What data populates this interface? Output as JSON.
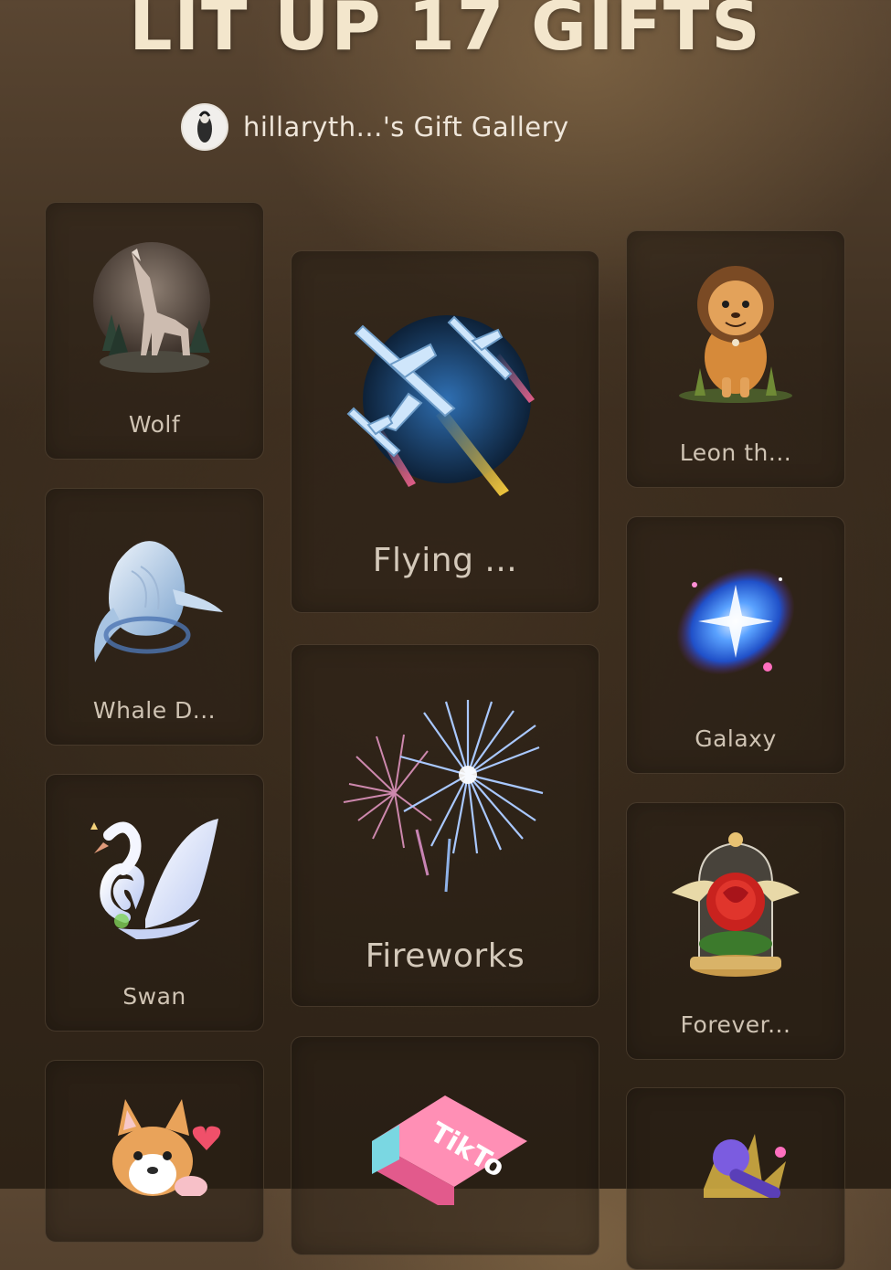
{
  "header": {
    "title": "LIT UP 17 GIFTS",
    "gallery_title": "hillaryth...'s Gift Gallery"
  },
  "gifts": {
    "wolf": {
      "label": "Wolf",
      "icon": "wolf-icon"
    },
    "flying": {
      "label": "Flying ...",
      "icon": "jets-icon"
    },
    "leon": {
      "label": "Leon th...",
      "icon": "lion-icon"
    },
    "whale": {
      "label": "Whale D...",
      "icon": "whale-icon"
    },
    "galaxy": {
      "label": "Galaxy",
      "icon": "galaxy-icon"
    },
    "fireworks": {
      "label": "Fireworks",
      "icon": "fireworks-icon"
    },
    "swan": {
      "label": "Swan",
      "icon": "swan-icon"
    },
    "forever": {
      "label": "Forever...",
      "icon": "rose-dome-icon"
    },
    "corgi": {
      "label": "",
      "icon": "corgi-icon"
    },
    "tiktok": {
      "label": "TikTo",
      "icon": "tiktok-box-icon"
    },
    "mic": {
      "label": "",
      "icon": "microphone-icon"
    }
  },
  "colors": {
    "background": "#3a2c1e",
    "title": "#f3e6cc",
    "label": "#cfc3b3"
  }
}
